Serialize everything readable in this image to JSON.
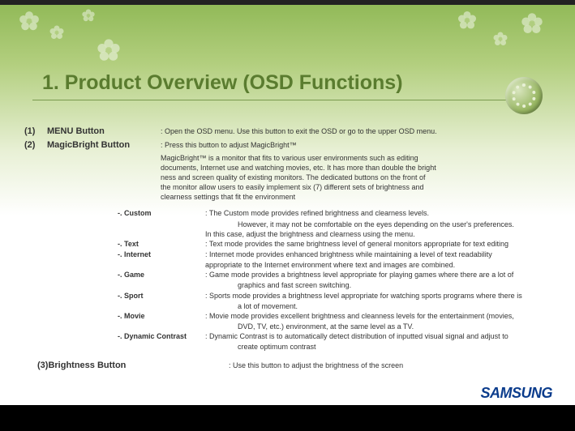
{
  "title": "1. Product Overview (OSD Functions)",
  "items": [
    {
      "num": "(1)",
      "label": "MENU Button",
      "desc": ": Open the OSD menu. Use this button to exit the OSD or go to the upper OSD menu."
    },
    {
      "num": "(2)",
      "label": "MagicBright Button",
      "desc": ": Press this button to adjust MagicBright™"
    }
  ],
  "magicbright_body": [
    "MagicBright™ is a monitor that fits to various user environments such as editing",
    "documents, Internet use and watching movies, etc. It has more than double the bright",
    "ness and screen quality of existing monitors. The dedicated buttons on the front of",
    "the monitor allow users to easily implement six (7) different sets of brightness and",
    "clearness settings that fit the environment"
  ],
  "modes": [
    {
      "name": "-. Custom",
      "desc": ": The Custom mode provides refined brightness and clearness levels.",
      "cont": [
        "   However, it may not be comfortable on the eyes depending on the user's preferences.",
        "In this case, adjust the brightness and clearness using the menu."
      ]
    },
    {
      "name": "-. Text",
      "desc": ": Text mode provides the same brightness level of general monitors appropriate for text editing"
    },
    {
      "name": "-. Internet",
      "desc": ": Internet mode provides enhanced brightness while maintaining a level of text readability",
      "cont": [
        "appropriate to the Internet environment where text and images are combined."
      ]
    },
    {
      "name": "-. Game",
      "desc": ": Game mode provides a brightness level appropriate for playing games where there are a lot of",
      "cont": [
        "   graphics and fast screen switching."
      ]
    },
    {
      "name": "-. Sport",
      "desc": ": Sports mode provides a brightness level appropriate for watching sports programs where there is",
      "cont": [
        "   a lot of movement."
      ]
    },
    {
      "name": "-. Movie",
      "desc": ": Movie mode provides excellent brightness and cleanness levels for the entertainment (movies,",
      "cont": [
        "   DVD, TV, etc.) environment, at the same level as a TV."
      ]
    },
    {
      "name": "-. Dynamic Contrast",
      "desc": ": Dynamic Contrast is to automatically detect distribution of inputted visual signal and adjust to",
      "cont": [
        "   create optimum contrast"
      ]
    }
  ],
  "item3": {
    "label": "(3)Brightness Button",
    "desc": ": Use this button to adjust the brightness of the screen"
  },
  "logo": "SAMSUNG"
}
